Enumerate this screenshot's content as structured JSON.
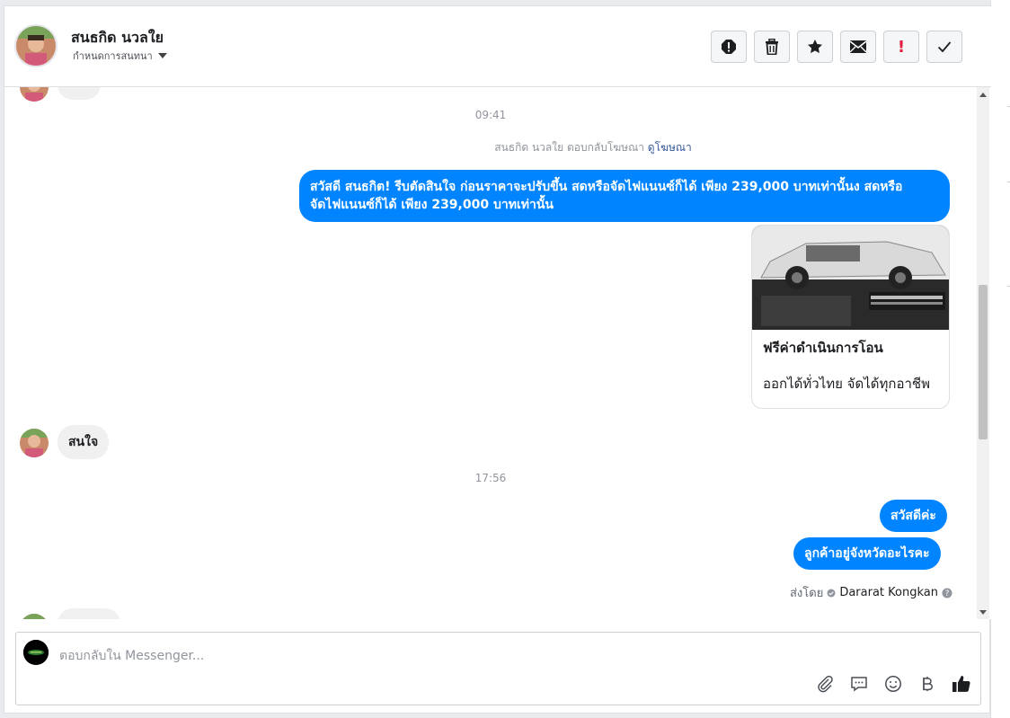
{
  "header": {
    "contact_name": "สนธกิด นวลใย",
    "sub_label": "กำหนดการสนทนา",
    "toolbar": [
      {
        "name": "report-icon",
        "title": "report"
      },
      {
        "name": "trash-icon",
        "title": "delete"
      },
      {
        "name": "star-icon",
        "title": "star"
      },
      {
        "name": "mail-icon",
        "title": "unread"
      },
      {
        "name": "exclamation-icon",
        "title": "spam",
        "color": "#e41e3f"
      },
      {
        "name": "check-icon",
        "title": "done"
      }
    ]
  },
  "thread": {
    "time1": "09:41",
    "ad_note_prefix": "สนธกิด นวลใย ตอบกลับโฆษณา",
    "ad_note_link": "ดูโฆษณา",
    "msg_out_1_line1": "สวัสดี สนธกิต! รีบตัดสินใจ ก่อนราคาจะปรับขึ้น สดหรือจัดไฟแนนซ์ก็ได้  เพียง 239,000 บาทเท่านั้นง สดหรือ",
    "msg_out_1_line2": "จัดไฟแนนซ์ก็ได้  เพียง 239,000 บาทเท่านั้น",
    "card_title": "ฟรีค่าดำเนินการโอน",
    "card_sub": "ออกได้ทั่วไทย จัดได้ทุกอาชีพ",
    "msg_in_1": "สนใจ",
    "time2": "17:56",
    "msg_out_2": "สวัสดีค่ะ",
    "msg_out_3": "ลูกค้าอยู่จังหวัดอะไรคะ",
    "sent_by_label": "ส่งโดย",
    "sent_by_name": "Dararat Kongkan"
  },
  "composer": {
    "placeholder": "ตอบกลับใน Messenger...",
    "icons": [
      "paperclip-icon",
      "chat-icon",
      "smiley-icon",
      "baht-icon",
      "thumbs-up-icon"
    ]
  },
  "colors": {
    "accent": "#0084ff",
    "incoming_bubble": "#f1f0f0"
  }
}
